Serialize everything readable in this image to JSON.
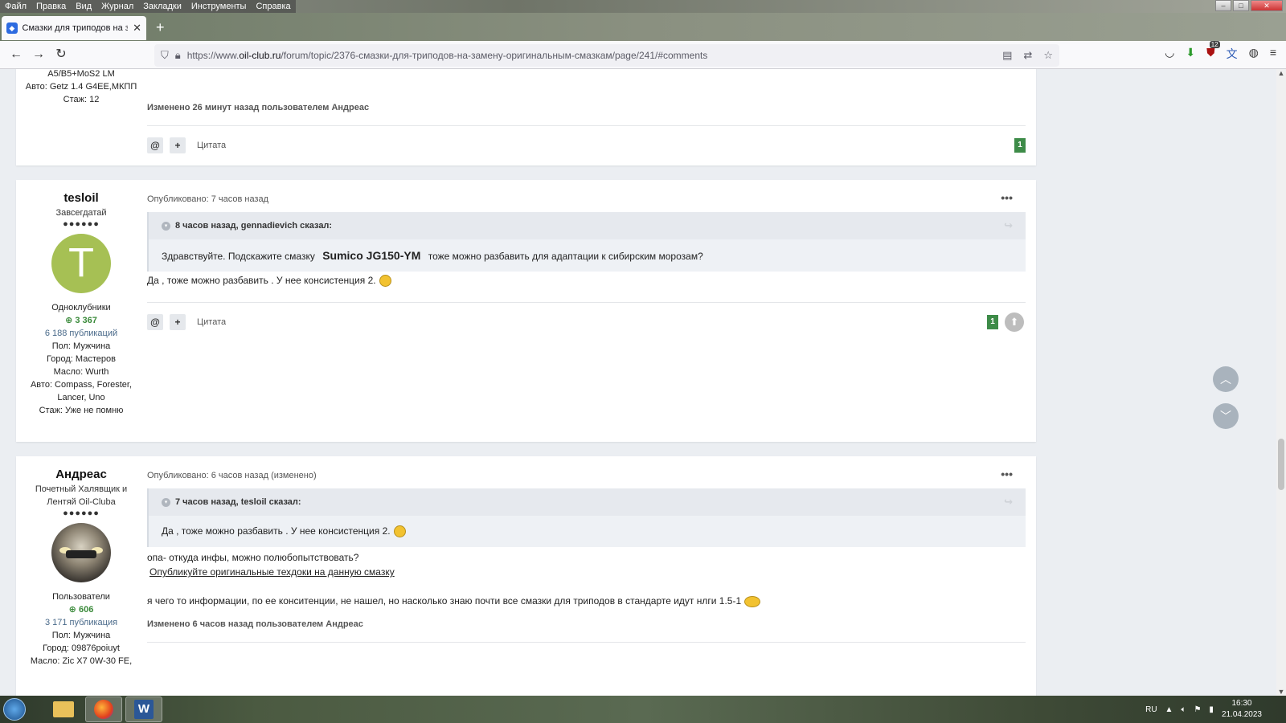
{
  "browser": {
    "menu": [
      "Файл",
      "Правка",
      "Вид",
      "Журнал",
      "Закладки",
      "Инструменты",
      "Справка"
    ],
    "tab_title": "Смазки для триподов на замену",
    "url_prefix": "https://www.",
    "url_domain": "oil-club.ru",
    "url_path": "/forum/topic/2376-смазки-для-триподов-на-замену-оригинальным-смазкам/page/241/#comments",
    "ext_badge": "12"
  },
  "post0": {
    "author_lines": [
      "A5/B5+MoS2 LM",
      "Авто: Getz 1.4 G4EE,МКПП",
      "Стаж: 12"
    ],
    "edited": "Изменено 26 минут назад пользователем Андреас",
    "quote_action": "Цитата",
    "rep": "1"
  },
  "post1": {
    "author": "tesloil",
    "rank": "Завсегдатай",
    "pips": "●●●●●●",
    "avatar_letter": "T",
    "group": "Одноклубники",
    "reputation": "3 367",
    "publications": "6 188 публикаций",
    "gender": "Пол: Мужчина",
    "city": "Город: Мастеров",
    "oil": "Масло: Wurth",
    "auto": "Авто: Compass, Forester,",
    "auto2": "Lancer, Uno",
    "experience": "Стаж: Уже не помню",
    "date": "Опубликовано: 7 часов назад",
    "quote_head": "8 часов назад, gennadievich сказал:",
    "quote_pre": "Здравствуйте. Подскажите смазку",
    "quote_bold": "Sumico JG150-YM",
    "quote_post": "тоже можно разбавить для адаптации к сибирским морозам?",
    "text": "Да , тоже можно разбавить . У нее консистенция 2.",
    "quote_action": "Цитата",
    "rep": "1"
  },
  "post2": {
    "author": "Андреас",
    "rank1": "Почетный Халявщик и",
    "rank2": "Лентяй Oil-Cluba",
    "pips": "●●●●●●",
    "group": "Пользователи",
    "reputation": "606",
    "publications": "3 171 публикация",
    "gender": "Пол: Мужчина",
    "city": "Город: 09876poiuyt",
    "oil": "Масло: Zic X7 0W-30 FE,",
    "date": "Опубликовано: 6 часов назад (изменено)",
    "quote_head": "7 часов назад, tesloil сказал:",
    "quote_text": "Да , тоже можно разбавить . У нее консистенция 2.",
    "line1": "опа- откуда инфы, можно полюбопытствовать?",
    "link": "Опубликуйте оригинальные техдоки на данную смазку",
    "line2": "я чего то информации, по ее конситенции,  не нашел, но насколько знаю почти все смазки для триподов в стандарте идут  нлги 1.5-1",
    "edited": "Изменено 6 часов назад пользователем Андреас"
  },
  "taskbar": {
    "lang": "RU",
    "time": "16:30",
    "date": "21.04.2023"
  },
  "colors": {
    "accent_green": "#3d8b48",
    "avatar_green": "#a6c054"
  }
}
